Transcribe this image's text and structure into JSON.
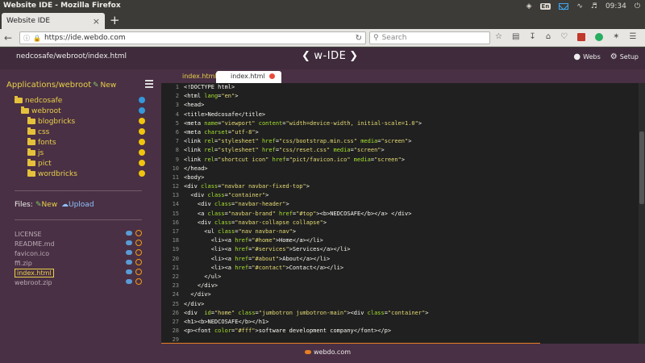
{
  "os": {
    "title": "Website IDE - Mozilla Firefox",
    "lang": "En",
    "time": "09:34"
  },
  "browser": {
    "tab_label": "Website IDE",
    "new_tab": "+",
    "url": "https://ide.webdo.com",
    "search_placeholder": "Search"
  },
  "ide": {
    "path": "nedcosafe/webroot/index.html",
    "title": "w-IDE",
    "webs_label": "Webs",
    "setup_label": "Setup"
  },
  "sidebar": {
    "heading": "Applications/webroot",
    "new_label": "New",
    "tree": [
      {
        "label": "nedcosafe",
        "indent": 0
      },
      {
        "label": "webroot",
        "indent": 1
      },
      {
        "label": "blogbricks",
        "indent": 2
      },
      {
        "label": "css",
        "indent": 2
      },
      {
        "label": "fonts",
        "indent": 2
      },
      {
        "label": "js",
        "indent": 2
      },
      {
        "label": "pict",
        "indent": 2
      },
      {
        "label": "wordbricks",
        "indent": 2
      }
    ],
    "files_label": "Files:",
    "files_new": "New",
    "files_upload": "Upload",
    "files": [
      "LICENSE",
      "README.md",
      "favicon.ico",
      "ffi.zip",
      "index.html",
      "webroot.zip"
    ],
    "active_file": "index.html"
  },
  "editor": {
    "tabs": [
      "index.html",
      "index.html"
    ],
    "lines": [
      "<!DOCTYPE html>",
      "<html lang=\"en\">",
      "<head>",
      "<title>Nedcosafe</title>",
      "<meta name=\"viewport\" content=\"width=device-width, initial-scale=1.0\">",
      "<meta charset=\"utf-8\">",
      "<link rel=\"stylesheet\" href=\"css/bootstrap.min.css\" media=\"screen\">",
      "<link rel=\"stylesheet\" href=\"css/reset.css\" media=\"screen\">",
      "<link rel=\"shortcut icon\" href=\"pict/favicon.ico\" media=\"screen\">",
      "</head>",
      "<body>",
      "<div class=\"navbar navbar-fixed-top\">",
      "  <div class=\"container\">",
      "    <div class=\"navbar-header\">",
      "    <a class=\"navbar-brand\" href=\"#top\"><b>NEDCOSAFE</b></a> </div>",
      "    <div class=\"navbar-collapse collapse\">",
      "      <ul class=\"nav navbar-nav\">",
      "        <li><a href=\"#home\">Home</a></li>",
      "        <li><a href=\"#services\">Services</a></li>",
      "        <li><a href=\"#about\">About</a></li>",
      "        <li><a href=\"#contact\">Contact</a></li>",
      "      </ul>",
      "    </div>",
      "  </div>",
      "</div>",
      "<div  id=\"home\" class=\"jumbotron jumbotron-main\"><div class=\"container\">",
      "<h1><b>NEDCOSAFE</b></h1>",
      "<p><font color=\"#fff\">software development company</font></p>",
      ""
    ]
  },
  "footer": {
    "brand": "webdo.com"
  }
}
